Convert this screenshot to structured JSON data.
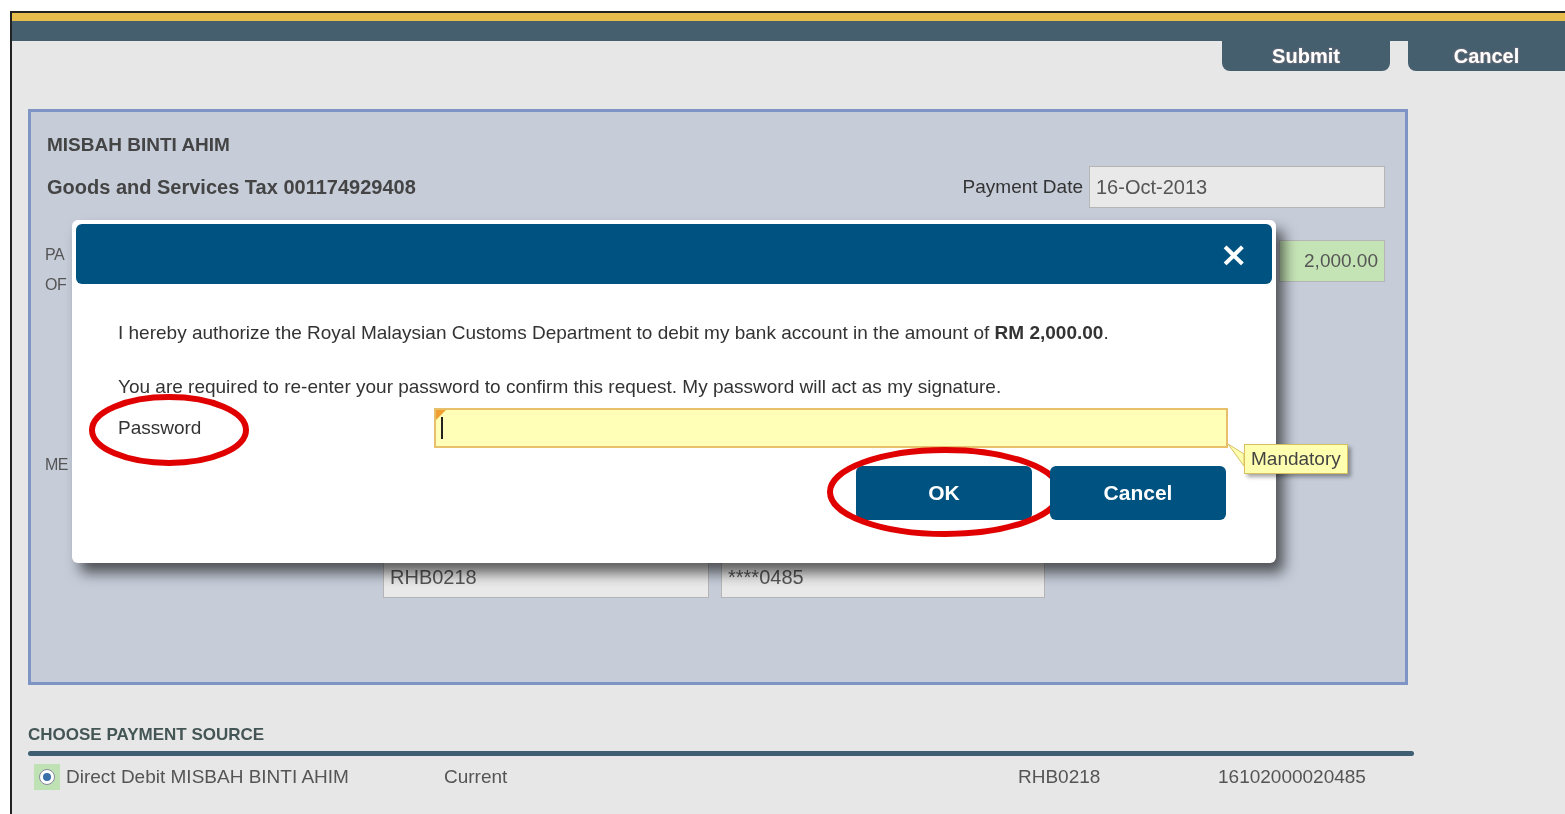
{
  "header": {
    "buttons": [
      "Submit",
      "Cancel"
    ]
  },
  "account": {
    "name": "MISBAH BINTI AHIM",
    "tax_line": "Goods and Services Tax 001174929408",
    "payment_date": {
      "label": "Payment Date",
      "value": "16-Oct-2013"
    },
    "cut_labels": [
      "PA",
      "OF"
    ],
    "amount": "2,000.00",
    "cut_label_2": "ME",
    "bank_code": "RHB0218",
    "account_no": "****0485"
  },
  "dialog": {
    "close": "×",
    "message": "I hereby authorize the Royal Malaysian Customs Department to debit my bank account in the amount of **RM 2,000.00**.",
    "instruction": "You are required to re-enter your password to confirm this request. My password will act as my signature.",
    "password": {
      "label": "Password",
      "highlighted": true,
      "tooltip": "Mandatory"
    },
    "buttons": [
      {
        "label": "OK",
        "highlighted": true
      },
      {
        "label": "Cancel",
        "highlighted": false
      }
    ]
  },
  "payment_source": {
    "title": "CHOOSE PAYMENT SOURCE",
    "options": [
      {
        "label": "Direct Debit MISBAH BINTI AHIM",
        "type": "Current",
        "bank": "RHB0218",
        "account": "16102000020485",
        "selected": true
      }
    ]
  }
}
